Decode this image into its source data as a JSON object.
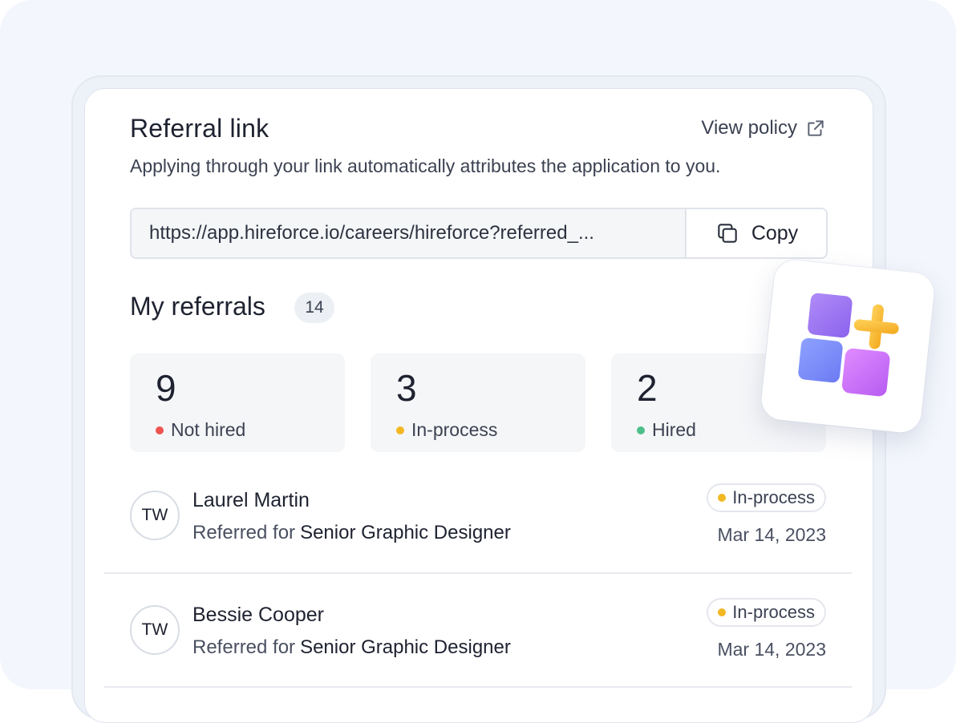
{
  "referral": {
    "title": "Referral link",
    "view_policy": "View policy",
    "subtitle": "Applying through your link automatically attributes the application to you.",
    "link_value": "https://app.hireforce.io/careers/hireforce?referred_...",
    "copy_label": "Copy"
  },
  "my_referrals": {
    "title": "My referrals",
    "count": "14",
    "stats": [
      {
        "value": "9",
        "label": "Not hired",
        "color": "#ef5350"
      },
      {
        "value": "3",
        "label": "In-process",
        "color": "#f2b824"
      },
      {
        "value": "2",
        "label": "Hired",
        "color": "#4fbf8a"
      }
    ],
    "list": [
      {
        "initials": "TW",
        "name": "Laurel Martin",
        "referred_prefix": "Referred for",
        "role": "Senior Graphic Designer",
        "status": "In-process",
        "status_color": "#f2b824",
        "date": "Mar 14, 2023"
      },
      {
        "initials": "TW",
        "name": "Bessie Cooper",
        "referred_prefix": "Referred for",
        "role": "Senior Graphic Designer",
        "status": "In-process",
        "status_color": "#f2b824",
        "date": "Mar 14, 2023"
      }
    ]
  },
  "icons": {
    "view_policy": "external-link-icon",
    "copy": "copy-icon",
    "widget": "add-apps-icon"
  }
}
